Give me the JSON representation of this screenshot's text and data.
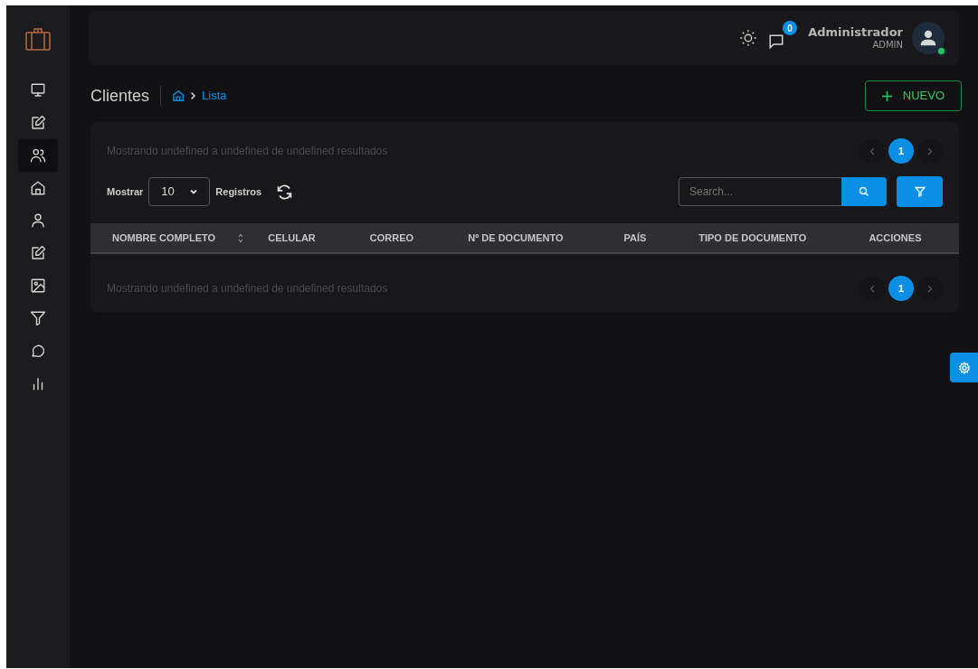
{
  "sidebar": {
    "items": [
      {
        "kind": "monitor",
        "selected": false
      },
      {
        "kind": "edit",
        "selected": false
      },
      {
        "kind": "users",
        "selected": true
      },
      {
        "kind": "home",
        "selected": false
      },
      {
        "kind": "user",
        "selected": false
      },
      {
        "kind": "edit",
        "selected": false
      },
      {
        "kind": "image",
        "selected": false
      },
      {
        "kind": "filter",
        "selected": false
      },
      {
        "kind": "chat",
        "selected": false
      },
      {
        "kind": "chart",
        "selected": false
      }
    ]
  },
  "header": {
    "notification_count": "0",
    "user_name": "Administrador",
    "user_role": "ADMIN",
    "online": true
  },
  "page": {
    "title": "Clientes",
    "breadcrumb": "Lista",
    "new_button": "NUEVO"
  },
  "table_card": {
    "summary_top": "Mostrando undefined a undefined de undefined resultados",
    "pagination_top": [
      {
        "label": "1",
        "selected": true
      }
    ],
    "show_label": "Mostrar",
    "page_size": "10",
    "records_label": "Registros",
    "search": {
      "placeholder": "Search..."
    },
    "columns": [
      {
        "label": "NOMBRE COMPLETO",
        "sortable": true
      },
      {
        "label": "CELULAR",
        "sortable": false
      },
      {
        "label": "CORREO",
        "sortable": false
      },
      {
        "label": "Nº DE DOCUMENTO",
        "sortable": false
      },
      {
        "label": "PAÍS",
        "sortable": false
      },
      {
        "label": "TIPO DE DOCUMENTO",
        "sortable": false
      },
      {
        "label": "ACCIONES",
        "sortable": false
      }
    ],
    "summary_bottom": "Mostrando undefined a undefined de undefined resultados",
    "pagination_bottom": [
      {
        "label": "1",
        "selected": true
      }
    ]
  }
}
